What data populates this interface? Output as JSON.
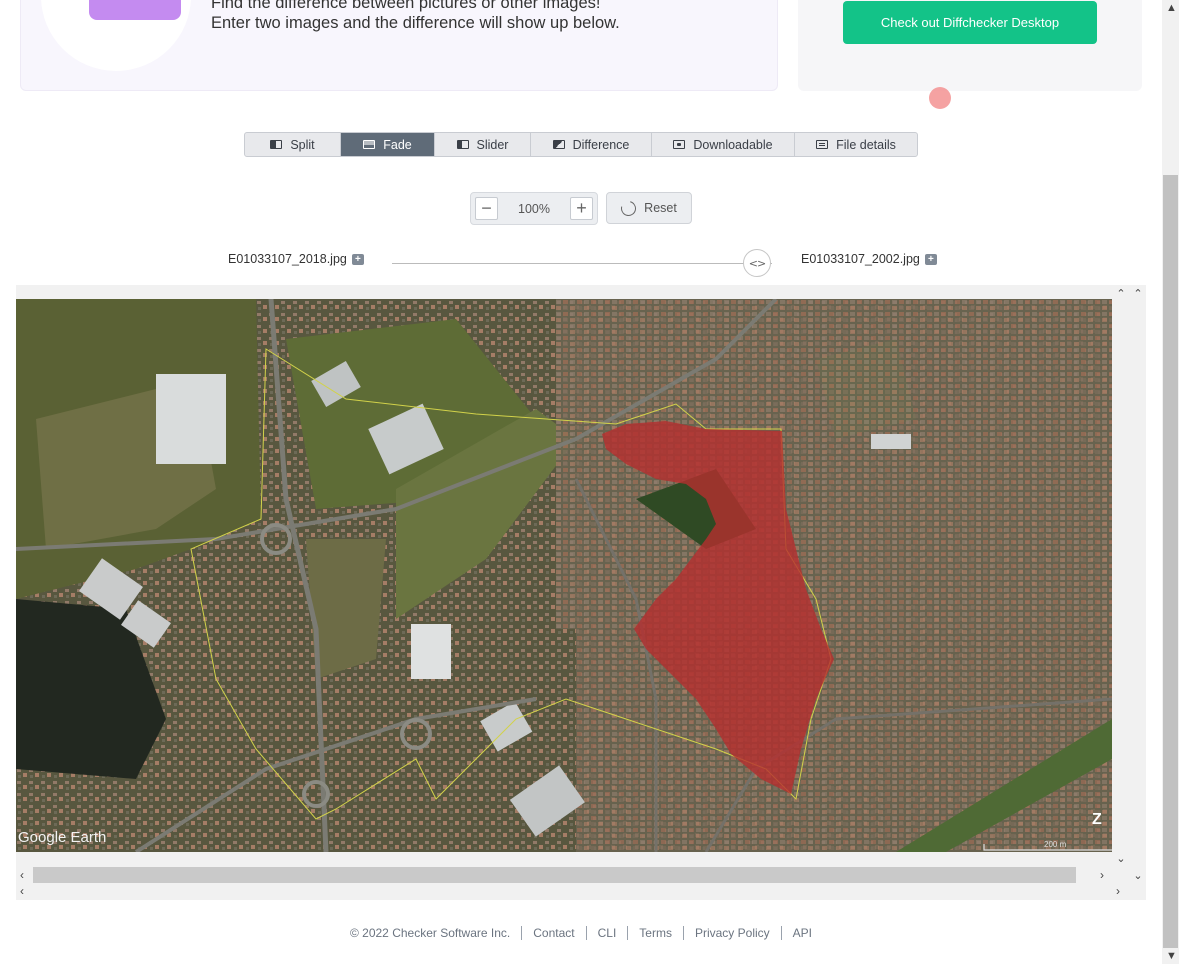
{
  "hero": {
    "line1": "Find the difference between pictures or other images!",
    "line2": "Enter two images and the difference will show up below."
  },
  "desktop_cta": {
    "label": "Check out Diffchecker Desktop",
    "color": "#13c388"
  },
  "view_tabs": [
    {
      "label": "Split",
      "icon": "split-view-icon",
      "active": false
    },
    {
      "label": "Fade",
      "icon": "fade-view-icon",
      "active": true
    },
    {
      "label": "Slider",
      "icon": "slider-view-icon",
      "active": false
    },
    {
      "label": "Difference",
      "icon": "difference-view-icon",
      "active": false
    },
    {
      "label": "Downloadable",
      "icon": "download-icon",
      "active": false
    },
    {
      "label": "File details",
      "icon": "file-details-icon",
      "active": false
    }
  ],
  "zoom": {
    "minus": "−",
    "value": "100%",
    "plus": "+"
  },
  "reset": {
    "label": "Reset",
    "icon": "reset-icon"
  },
  "files": {
    "left": "E01033107_2018.jpg",
    "right": "E01033107_2002.jpg",
    "fade_level": 0.97
  },
  "map": {
    "watermark": "Google Earth",
    "scale_label": "200 m",
    "highlight_color": "#b52e2e"
  },
  "footer": {
    "items": [
      "© 2022 Checker Software Inc.",
      "Contact",
      "CLI",
      "Terms",
      "Privacy Policy",
      "API"
    ]
  }
}
